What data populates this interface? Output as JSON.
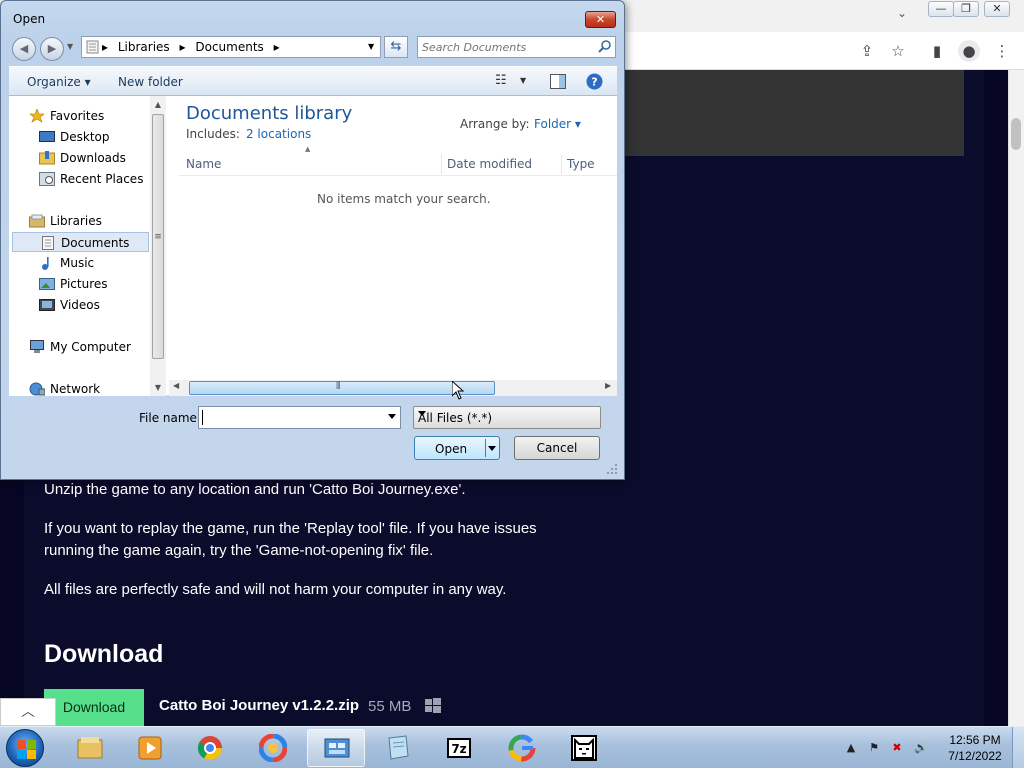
{
  "browser": {
    "window_controls": [
      "—",
      "❐",
      "✕"
    ]
  },
  "page": {
    "paragraphs": [
      "Unzip the game to any location and run 'Catto Boi Journey.exe'.",
      "If you want to replay the game, run the 'Replay tool' file. If you have issues",
      "running the game again, try the 'Game-not-opening fix' file.",
      "All files are perfectly safe and will not harm your computer in any way."
    ],
    "heading": "Download",
    "download_button": "Download",
    "file_name": "Catto Boi Journey v1.2.2.zip",
    "file_size": "55 MB"
  },
  "dialog": {
    "title": "Open",
    "breadcrumbs": [
      "Libraries",
      "Documents"
    ],
    "search_placeholder": "Search Documents",
    "toolbar": {
      "organize": "Organize ▾",
      "new_folder": "New folder"
    },
    "nav": {
      "favorites": "Favorites",
      "desktop": "Desktop",
      "downloads": "Downloads",
      "recent_places": "Recent Places",
      "libraries": "Libraries",
      "documents": "Documents",
      "music": "Music",
      "pictures": "Pictures",
      "videos": "Videos",
      "my_computer": "My Computer",
      "network": "Network"
    },
    "library_title": "Documents library",
    "includes_label": "Includes:",
    "includes_link": "2 locations",
    "arrange_label": "Arrange by:",
    "arrange_value": "Folder ▾",
    "columns": [
      "Name",
      "Date modified",
      "Type"
    ],
    "empty_message": "No items match your search.",
    "file_name_label": "File name:",
    "file_name_value": "",
    "file_type": "All Files (*.*)",
    "open_label": "Open",
    "cancel_label": "Cancel"
  },
  "taskbar": {
    "time": "12:56 PM",
    "date": "7/12/2022"
  },
  "colors": {
    "page_bg": "#0b0b2c",
    "download_green": "#56e08c",
    "library_title_blue": "#1e5799"
  }
}
